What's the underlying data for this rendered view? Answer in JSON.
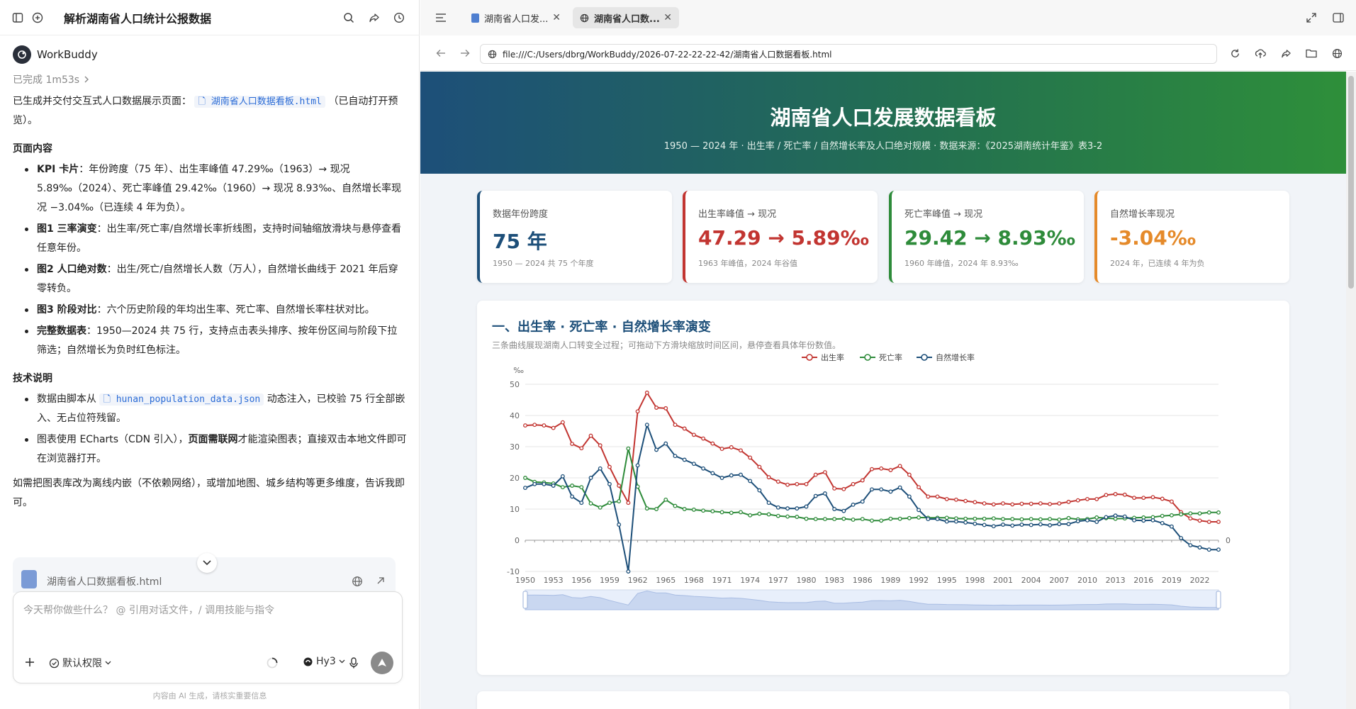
{
  "chat": {
    "title": "解析湖南省人口统计公报数据",
    "agent_name": "WorkBuddy",
    "status": "已完成 1m53s",
    "intro_before": "已生成并交付交互式人口数据展示页面：",
    "intro_file": "湖南省人口数据看板.html",
    "intro_after": "（已自动打开预览）。",
    "section1": "页面内容",
    "items1": [
      {
        "bold": "KPI 卡片",
        "text": "：年份跨度（75 年）、出生率峰值 47.29‰（1963）→ 现况 5.89‰（2024）、死亡率峰值 29.42‰（1960）→ 现况 8.93‰、自然增长率现况 −3.04‰（已连续 4 年为负）。"
      },
      {
        "bold": "图1 三率演变",
        "text": "：出生率/死亡率/自然增长率折线图，支持时间轴缩放滑块与悬停查看任意年份。"
      },
      {
        "bold": "图2 人口绝对数",
        "text": "：出生/死亡/自然增长人数（万人），自然增长曲线于 2021 年后穿零转负。"
      },
      {
        "bold": "图3 阶段对比",
        "text": "：六个历史阶段的年均出生率、死亡率、自然增长率柱状对比。"
      },
      {
        "bold": "完整数据表",
        "text": "：1950—2024 共 75 行，支持点击表头排序、按年份区间与阶段下拉筛选；自然增长为负时红色标注。"
      }
    ],
    "section2": "技术说明",
    "tech1_before": "数据由脚本从",
    "tech1_file": "hunan_population_data.json",
    "tech1_after": "动态注入，已校验 75 行全部嵌入、无占位符残留。",
    "tech2_before": "图表使用 ECharts（CDN 引入），",
    "tech2_bold": "页面需联网",
    "tech2_after": "才能渲染图表；直接双击本地文件即可在浏览器打开。",
    "closing": "如需把图表库改为离线内嵌（不依赖网络），或增加地图、城乡结构等更多维度，告诉我即可。",
    "preview_file": "湖南省人口数据看板.html",
    "composer_placeholder": "今天帮你做些什么？ @ 引用对话文件，/ 调用技能与指令",
    "permission": "默认权限",
    "model": "Hy3",
    "disclaimer": "内容由 AI 生成，请核实重要信息"
  },
  "browser": {
    "tab1": "湖南省人口发...",
    "tab2": "湖南省人口数...",
    "url": "file:///C:/Users/dbrg/WorkBuddy/2026-07-22-22-22-42/湖南省人口数据看板.html"
  },
  "dashboard": {
    "title": "湖南省人口发展数据看板",
    "subtitle": "1950 — 2024 年 · 出生率 / 死亡率 / 自然增长率及人口绝对规模 · 数据来源：《2025湖南统计年鉴》表3-2",
    "kpis": [
      {
        "label": "数据年份跨度",
        "value": "75 年",
        "sub": "1950 — 2024 共 75 个年度"
      },
      {
        "label": "出生率峰值 → 现况",
        "value": "47.29 → 5.89‰",
        "sub": "1963 年峰值，2024 年谷值"
      },
      {
        "label": "死亡率峰值 → 现况",
        "value": "29.42 → 8.93‰",
        "sub": "1960 年峰值，2024 年 8.93‰"
      },
      {
        "label": "自然增长率现况",
        "value": "-3.04‰",
        "sub": "2024 年，已连续 4 年为负"
      }
    ],
    "chart_title": "一、出生率 · 死亡率 · 自然增长率演变",
    "chart_desc": "三条曲线展现湖南人口转变全过程；可拖动下方滑块缩放时间区间，悬停查看具体年份数值。"
  },
  "colors": {
    "birth": "#c23531",
    "death": "#2e8b3a",
    "natural": "#1d4f79",
    "accent": "#e58a2a"
  },
  "chart_data": {
    "type": "line",
    "ylabel": "‰",
    "ylim": [
      -10,
      50
    ],
    "yticks": [
      -10,
      0,
      10,
      20,
      30,
      40,
      50
    ],
    "xticks": [
      1950,
      1953,
      1956,
      1959,
      1962,
      1965,
      1968,
      1971,
      1974,
      1977,
      1980,
      1983,
      1986,
      1989,
      1992,
      1995,
      1998,
      2001,
      2004,
      2007,
      2010,
      2013,
      2016,
      2019,
      2022
    ],
    "right_label": "0",
    "legend_position": "top-center",
    "grid": true,
    "x_start": 1950,
    "series": [
      {
        "name": "出生率",
        "color": "#c23531",
        "values": [
          36.8,
          37.0,
          36.8,
          36.0,
          37.8,
          30.9,
          29.5,
          33.5,
          30.4,
          23.5,
          17.5,
          12.0,
          41.3,
          47.3,
          42.5,
          42.3,
          37.0,
          35.8,
          33.8,
          32.6,
          31.0,
          29.3,
          29.8,
          28.8,
          26.5,
          23.5,
          20.2,
          18.8,
          17.8,
          18.0,
          18.0,
          21.0,
          21.8,
          16.6,
          16.4,
          18.0,
          19.2,
          22.8,
          23.0,
          22.5,
          23.8,
          21.0,
          17.0,
          14.0,
          14.0,
          13.2,
          13.0,
          12.6,
          12.2,
          11.8,
          11.5,
          11.8,
          11.5,
          11.7,
          11.7,
          11.8,
          11.6,
          11.8,
          12.3,
          12.8,
          13.2,
          13.2,
          14.5,
          14.8,
          14.6,
          13.6,
          13.6,
          13.8,
          13.3,
          12.4,
          9.0,
          7.0,
          6.3,
          5.9,
          5.9
        ]
      },
      {
        "name": "死亡率",
        "color": "#2e8b3a",
        "values": [
          20.0,
          18.7,
          18.5,
          18.2,
          17.0,
          17.5,
          17.0,
          11.8,
          10.5,
          12.0,
          12.5,
          29.4,
          17.2,
          10.2,
          10.0,
          13.0,
          11.0,
          10.0,
          9.8,
          9.5,
          9.3,
          9.0,
          8.8,
          9.0,
          8.0,
          8.5,
          8.3,
          7.8,
          7.6,
          7.5,
          6.9,
          6.8,
          6.8,
          6.8,
          6.9,
          6.6,
          6.8,
          6.3,
          6.3,
          6.9,
          6.9,
          7.1,
          7.3,
          7.2,
          7.2,
          7.2,
          7.0,
          6.9,
          6.9,
          6.9,
          7.0,
          6.8,
          6.8,
          6.7,
          6.8,
          6.7,
          6.8,
          6.6,
          7.1,
          6.7,
          6.8,
          7.3,
          7.1,
          6.9,
          7.0,
          7.2,
          7.3,
          7.4,
          7.8,
          8.0,
          8.3,
          8.6,
          8.6,
          8.9,
          8.9
        ]
      },
      {
        "name": "自然增长率",
        "color": "#1d4f79",
        "values": [
          16.8,
          18.0,
          18.0,
          17.5,
          20.5,
          14.0,
          12.0,
          20.0,
          23.0,
          18.0,
          5.0,
          -10.0,
          24.0,
          37.0,
          29.0,
          31.0,
          27.0,
          25.8,
          24.5,
          23.0,
          21.5,
          20.0,
          20.8,
          21.0,
          19.0,
          16.0,
          12.0,
          10.5,
          10.2,
          10.2,
          10.8,
          14.2,
          15.0,
          10.0,
          9.4,
          11.4,
          12.4,
          16.3,
          16.3,
          15.6,
          16.9,
          14.0,
          9.7,
          6.8,
          6.8,
          6.0,
          6.0,
          5.7,
          5.3,
          4.9,
          4.5,
          5.0,
          4.7,
          5.0,
          4.9,
          5.1,
          4.8,
          5.2,
          5.2,
          6.1,
          6.4,
          5.9,
          7.4,
          7.9,
          7.6,
          6.4,
          6.3,
          6.4,
          5.5,
          4.4,
          0.7,
          -1.6,
          -2.3,
          -3.0,
          -3.0
        ]
      }
    ]
  }
}
